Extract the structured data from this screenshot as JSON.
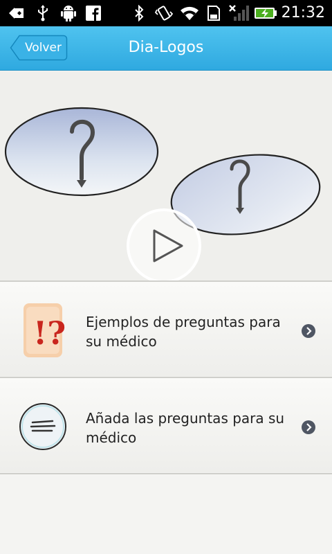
{
  "status_bar": {
    "time": "21:32",
    "icons": [
      "back-arrow-icon",
      "usb-icon",
      "android-debug-icon",
      "facebook-icon",
      "bluetooth-icon",
      "vibrate-icon",
      "wifi-icon",
      "sd-card-icon",
      "no-signal-icon",
      "battery-charging-icon"
    ]
  },
  "header": {
    "back_label": "Volver",
    "title": "Dia-Logos",
    "background": "#3bb4e6"
  },
  "hero": {
    "video": "play-icon",
    "illustration": "question-bubbles"
  },
  "menu": [
    {
      "label": "Ejemplos de preguntas para su médico",
      "icon": "exclamation-question-icon"
    },
    {
      "label": "Añada las preguntas para su médico",
      "icon": "notes-icon"
    }
  ]
}
